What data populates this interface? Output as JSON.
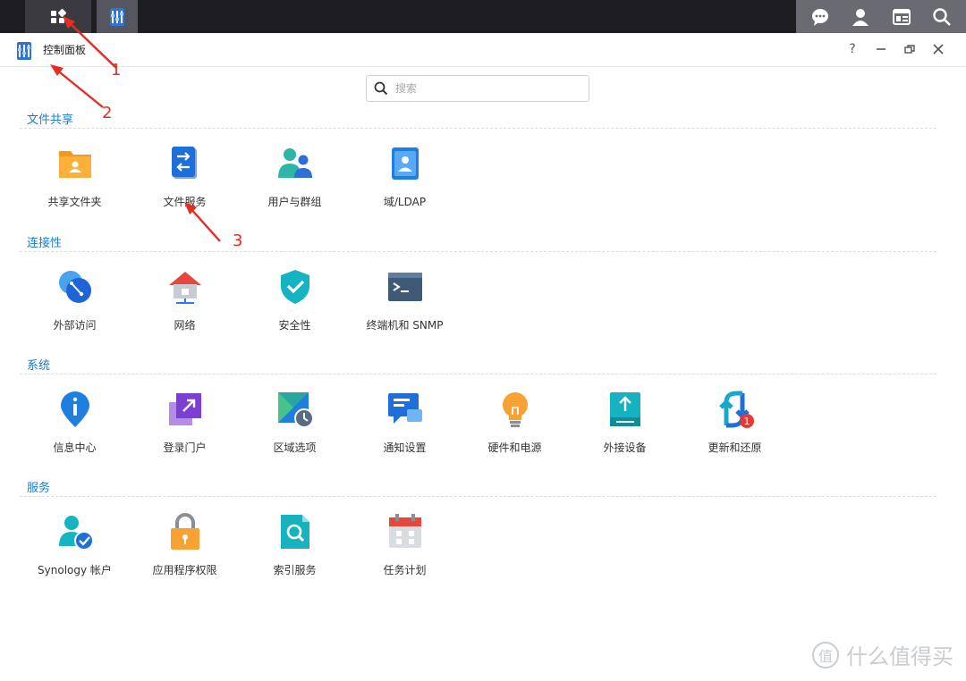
{
  "window": {
    "title": "控制面板"
  },
  "search": {
    "placeholder": "搜索"
  },
  "sections": [
    {
      "title": "文件共享",
      "items": [
        {
          "label": "共享文件夹",
          "icon": "shared-folder-icon"
        },
        {
          "label": "文件服务",
          "icon": "file-services-icon"
        },
        {
          "label": "用户与群组",
          "icon": "user-group-icon"
        },
        {
          "label": "域/LDAP",
          "icon": "domain-ldap-icon"
        }
      ]
    },
    {
      "title": "连接性",
      "items": [
        {
          "label": "外部访问",
          "icon": "external-access-icon"
        },
        {
          "label": "网络",
          "icon": "network-icon"
        },
        {
          "label": "安全性",
          "icon": "security-shield-icon"
        },
        {
          "label": "终端机和 SNMP",
          "icon": "terminal-icon"
        }
      ]
    },
    {
      "title": "系统",
      "items": [
        {
          "label": "信息中心",
          "icon": "info-center-icon"
        },
        {
          "label": "登录门户",
          "icon": "login-portal-icon"
        },
        {
          "label": "区域选项",
          "icon": "regional-options-icon"
        },
        {
          "label": "通知设置",
          "icon": "notification-icon"
        },
        {
          "label": "硬件和电源",
          "icon": "hardware-power-icon"
        },
        {
          "label": "外接设备",
          "icon": "external-devices-icon"
        },
        {
          "label": "更新和还原",
          "icon": "update-restore-icon",
          "badge": "1"
        }
      ]
    },
    {
      "title": "服务",
      "items": [
        {
          "label": "Synology 帐户",
          "icon": "synology-account-icon"
        },
        {
          "label": "应用程序权限",
          "icon": "app-privileges-icon"
        },
        {
          "label": "索引服务",
          "icon": "indexing-service-icon"
        },
        {
          "label": "任务计划",
          "icon": "task-scheduler-icon"
        }
      ]
    }
  ],
  "annotations": [
    "1",
    "2",
    "3"
  ],
  "watermark": {
    "logo": "值",
    "text": "什么值得买"
  },
  "colors": {
    "accent": "#1b7bd0",
    "annotation": "#e52d20"
  }
}
